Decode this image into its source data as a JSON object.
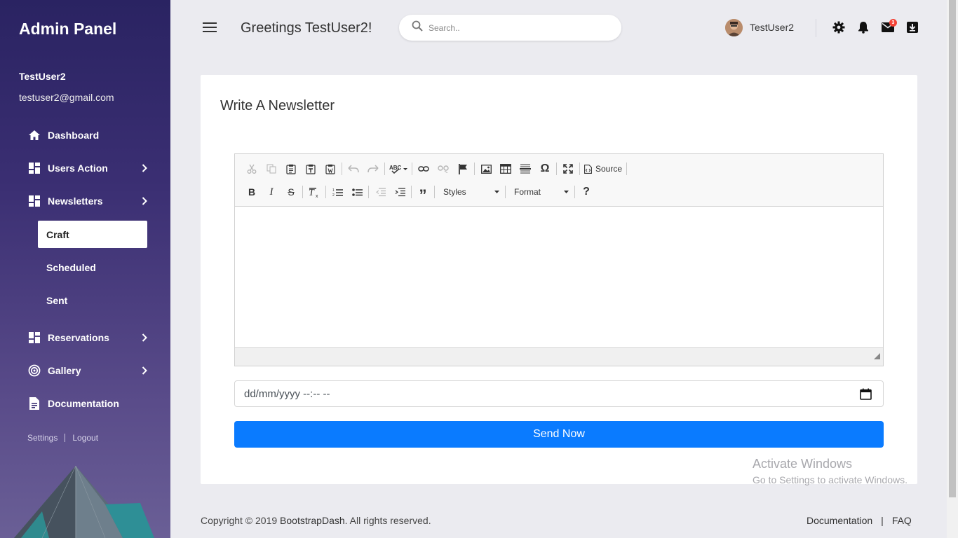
{
  "sidebar": {
    "brand": "Admin Panel",
    "user_name": "TestUser2",
    "user_email": "testuser2@gmail.com",
    "items": [
      {
        "label": "Dashboard",
        "icon": "home-icon"
      },
      {
        "label": "Users Action",
        "icon": "grid-icon"
      },
      {
        "label": "Newsletters",
        "icon": "grid-icon"
      },
      {
        "label": "Reservations",
        "icon": "grid-icon"
      },
      {
        "label": "Gallery",
        "icon": "target-icon"
      },
      {
        "label": "Documentation",
        "icon": "document-icon"
      }
    ],
    "subitems": [
      {
        "label": "Craft",
        "active": true
      },
      {
        "label": "Scheduled"
      },
      {
        "label": "Sent"
      }
    ],
    "settings_label": "Settings",
    "logout_label": "Logout"
  },
  "header": {
    "greeting": "Greetings TestUser2!",
    "search_placeholder": "Search..",
    "username": "TestUser2",
    "mail_badge": "3"
  },
  "main": {
    "card_title": "Write A Newsletter",
    "editor": {
      "source_label": "Source",
      "styles_label": "Styles",
      "format_label": "Format"
    },
    "datetime_placeholder": "dd/mm/yyyy --:-- --",
    "send_label": "Send Now"
  },
  "watermark": {
    "line1": "Activate Windows",
    "line2": "Go to Settings to activate Windows."
  },
  "footer": {
    "copyright_prefix": "Copyright © 2019 ",
    "brand": "BootstrapDash",
    "copyright_suffix": ". All rights reserved.",
    "doc_link": "Documentation",
    "faq_link": "FAQ"
  },
  "colors": {
    "sidebar_top": "#2a2362",
    "accent": "#0a7bff",
    "badge": "#f44336"
  }
}
